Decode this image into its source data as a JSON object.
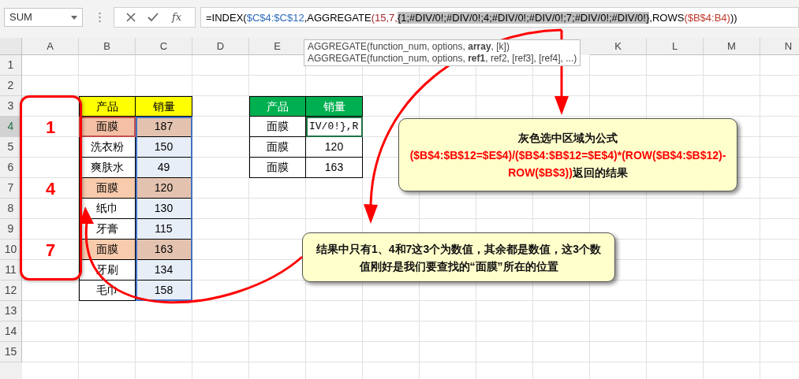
{
  "name_box": {
    "value": "SUM"
  },
  "function_button": "fx",
  "formula_bar": {
    "segments": [
      {
        "text": "=INDEX(",
        "selected": false
      },
      {
        "text": "$C$4:$C$12",
        "color": "#2f6eba",
        "selected": false
      },
      {
        "text": ",AGGREGATE",
        "selected": false
      },
      {
        "text": "(15,7,",
        "color": "#a0282d",
        "selected": false
      },
      {
        "text": "{1;#DIV/0!;#DIV/0!;4;#DIV/0!;#DIV/0!;7;#DIV/0!;#DIV/0!}",
        "selected": true
      },
      {
        "text": ",ROWS",
        "selected": false
      },
      {
        "text": "($B$4:B4)",
        "color": "#c0392b",
        "selected": false
      },
      {
        "text": "))",
        "selected": false
      }
    ]
  },
  "tooltip": {
    "lines": [
      "AGGREGATE(function_num, options, **array**, [k])",
      "AGGREGATE(function_num, options, **ref1**, ref2, [ref3], [ref4], ...)"
    ]
  },
  "column_headers_left": [
    "A",
    "B",
    "C",
    "D",
    "E"
  ],
  "column_headers_right": [
    "K",
    "L",
    "M",
    "N"
  ],
  "rows": [
    {
      "label": "1",
      "selected": false
    },
    {
      "label": "2",
      "selected": false
    },
    {
      "label": "3",
      "selected": false
    },
    {
      "label": "4",
      "selected": true
    },
    {
      "label": "5",
      "selected": false
    },
    {
      "label": "6",
      "selected": false
    },
    {
      "label": "7",
      "selected": false
    },
    {
      "label": "8",
      "selected": false
    },
    {
      "label": "9",
      "selected": false
    },
    {
      "label": "10",
      "selected": false
    },
    {
      "label": "11",
      "selected": false
    },
    {
      "label": "12",
      "selected": false
    },
    {
      "label": "13",
      "selected": false
    },
    {
      "label": "14",
      "selected": false
    },
    {
      "label": "15",
      "selected": false
    }
  ],
  "markers": [
    "1",
    "4",
    "7"
  ],
  "product_table": {
    "header": [
      {
        "text": "产品",
        "color": "#ffff00"
      },
      {
        "text": "销量",
        "color": "#ffff00"
      }
    ],
    "rows": [
      [
        {
          "text": "面膜",
          "color": "#f4bfa4"
        },
        {
          "text": "187",
          "color": "#e3c3b0"
        }
      ],
      [
        {
          "text": "洗衣粉"
        },
        {
          "text": "150",
          "color": "#e8eef8"
        }
      ],
      [
        {
          "text": "爽肤水"
        },
        {
          "text": "49",
          "color": "#e8eef8"
        }
      ],
      [
        {
          "text": "面膜",
          "color": "#f8cbad"
        },
        {
          "text": "120",
          "color": "#e3c3b0"
        }
      ],
      [
        {
          "text": "纸巾"
        },
        {
          "text": "130",
          "color": "#e8eef8"
        }
      ],
      [
        {
          "text": "牙膏"
        },
        {
          "text": "115",
          "color": "#e8eef8"
        }
      ],
      [
        {
          "text": "面膜",
          "color": "#f8cbad"
        },
        {
          "text": "163",
          "color": "#e3c3b0"
        }
      ],
      [
        {
          "text": "牙刷"
        },
        {
          "text": "134",
          "color": "#e8eef8"
        }
      ],
      [
        {
          "text": "毛巾"
        },
        {
          "text": "158",
          "color": "#e8eef8"
        }
      ]
    ]
  },
  "lookup_table": {
    "header": [
      {
        "text": "产品",
        "color": "#00b050"
      },
      {
        "text": "销量",
        "color": "#00b050"
      }
    ],
    "rows": [
      [
        {
          "text": "面膜",
          "kind": "text"
        },
        {
          "text": "IV/0!},R",
          "kind": "editing"
        }
      ],
      [
        {
          "text": "面膜",
          "kind": "text"
        },
        {
          "text": "120",
          "kind": "text"
        }
      ],
      [
        {
          "text": "面膜",
          "kind": "text"
        },
        {
          "text": "163",
          "kind": "text"
        }
      ]
    ]
  },
  "reference_highlights": [
    {
      "color": "#c0504d"
    },
    {
      "color": "#4472c4"
    }
  ],
  "callouts": [
    {
      "paragraphs": [
        [
          {
            "text": "灰色选中区域为公式",
            "emphasis": false
          }
        ],
        [
          {
            "text": "($B$4:$B$12=$E$4)/($B$4:$B$12=$E$4)*(ROW($B$4:$B$12)-ROW($B$3))",
            "emphasis": true
          },
          {
            "text": "返回的结果",
            "emphasis": false
          }
        ]
      ]
    },
    {
      "paragraphs": [
        [
          {
            "text": "结果中只有1、4和7这3个为数值，其余都是数值，这3个数值刚好是我们要查找的“面膜”所在的位置",
            "emphasis": false
          }
        ]
      ]
    }
  ]
}
